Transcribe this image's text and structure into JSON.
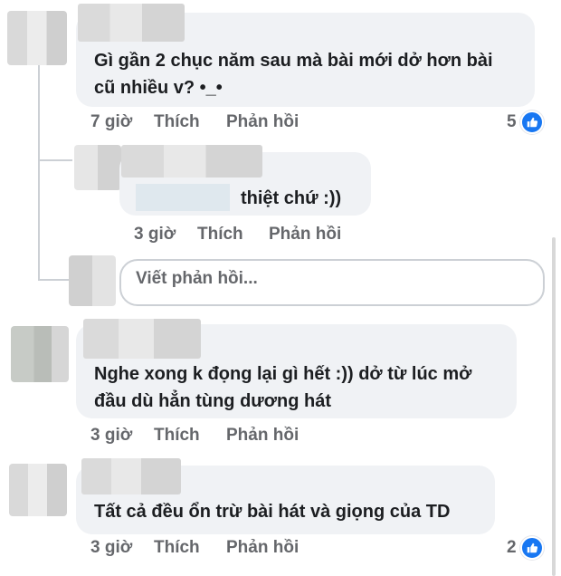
{
  "comments": [
    {
      "text_lines": [
        "Gì gần 2 chục năm sau mà bài mới dở hơn bài",
        "cũ nhiều v? •_•"
      ],
      "time": "7 giờ",
      "like_label": "Thích",
      "reply_label": "Phản hồi",
      "reaction_count": "5"
    },
    {
      "text_lines": [
        "Nghe xong k đọng lại gì hết :)) dở từ lúc mở",
        "đầu dù hẳn tùng dương hát"
      ],
      "time": "3 giờ",
      "like_label": "Thích",
      "reply_label": "Phản hồi"
    },
    {
      "text_lines": [
        "Tất cả đều ổn trừ bài hát và giọng của TD"
      ],
      "time": "3 giờ",
      "like_label": "Thích",
      "reply_label": "Phản hồi",
      "reaction_count": "2"
    }
  ],
  "reply": {
    "text": "thiệt chứ :))",
    "time": "3 giờ",
    "like_label": "Thích",
    "reply_label": "Phản hồi"
  },
  "reply_input": {
    "placeholder": "Viết phản hồi..."
  },
  "colors": {
    "bubble": "#f0f2f5",
    "meta_text": "#65676b",
    "like_blue": "#1877f2"
  },
  "icons": {
    "reaction": "like-thumb-icon"
  }
}
